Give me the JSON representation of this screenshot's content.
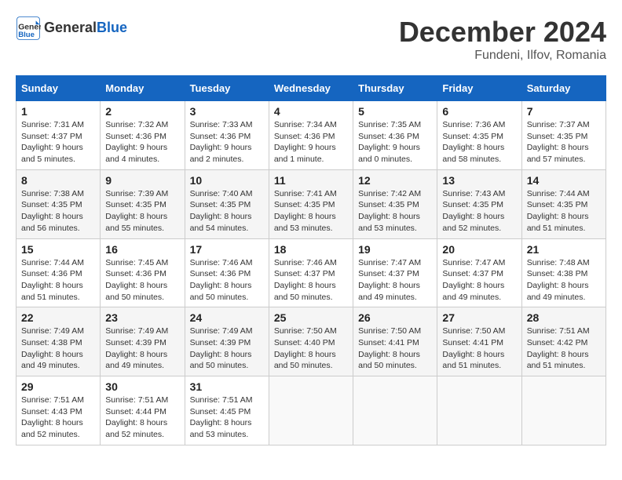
{
  "header": {
    "logo_line1": "General",
    "logo_line2": "Blue",
    "month_title": "December 2024",
    "subtitle": "Fundeni, Ilfov, Romania"
  },
  "days_of_week": [
    "Sunday",
    "Monday",
    "Tuesday",
    "Wednesday",
    "Thursday",
    "Friday",
    "Saturday"
  ],
  "weeks": [
    [
      {
        "day": "1",
        "details": "Sunrise: 7:31 AM\nSunset: 4:37 PM\nDaylight: 9 hours\nand 5 minutes."
      },
      {
        "day": "2",
        "details": "Sunrise: 7:32 AM\nSunset: 4:36 PM\nDaylight: 9 hours\nand 4 minutes."
      },
      {
        "day": "3",
        "details": "Sunrise: 7:33 AM\nSunset: 4:36 PM\nDaylight: 9 hours\nand 2 minutes."
      },
      {
        "day": "4",
        "details": "Sunrise: 7:34 AM\nSunset: 4:36 PM\nDaylight: 9 hours\nand 1 minute."
      },
      {
        "day": "5",
        "details": "Sunrise: 7:35 AM\nSunset: 4:36 PM\nDaylight: 9 hours\nand 0 minutes."
      },
      {
        "day": "6",
        "details": "Sunrise: 7:36 AM\nSunset: 4:35 PM\nDaylight: 8 hours\nand 58 minutes."
      },
      {
        "day": "7",
        "details": "Sunrise: 7:37 AM\nSunset: 4:35 PM\nDaylight: 8 hours\nand 57 minutes."
      }
    ],
    [
      {
        "day": "8",
        "details": "Sunrise: 7:38 AM\nSunset: 4:35 PM\nDaylight: 8 hours\nand 56 minutes."
      },
      {
        "day": "9",
        "details": "Sunrise: 7:39 AM\nSunset: 4:35 PM\nDaylight: 8 hours\nand 55 minutes."
      },
      {
        "day": "10",
        "details": "Sunrise: 7:40 AM\nSunset: 4:35 PM\nDaylight: 8 hours\nand 54 minutes."
      },
      {
        "day": "11",
        "details": "Sunrise: 7:41 AM\nSunset: 4:35 PM\nDaylight: 8 hours\nand 53 minutes."
      },
      {
        "day": "12",
        "details": "Sunrise: 7:42 AM\nSunset: 4:35 PM\nDaylight: 8 hours\nand 53 minutes."
      },
      {
        "day": "13",
        "details": "Sunrise: 7:43 AM\nSunset: 4:35 PM\nDaylight: 8 hours\nand 52 minutes."
      },
      {
        "day": "14",
        "details": "Sunrise: 7:44 AM\nSunset: 4:35 PM\nDaylight: 8 hours\nand 51 minutes."
      }
    ],
    [
      {
        "day": "15",
        "details": "Sunrise: 7:44 AM\nSunset: 4:36 PM\nDaylight: 8 hours\nand 51 minutes."
      },
      {
        "day": "16",
        "details": "Sunrise: 7:45 AM\nSunset: 4:36 PM\nDaylight: 8 hours\nand 50 minutes."
      },
      {
        "day": "17",
        "details": "Sunrise: 7:46 AM\nSunset: 4:36 PM\nDaylight: 8 hours\nand 50 minutes."
      },
      {
        "day": "18",
        "details": "Sunrise: 7:46 AM\nSunset: 4:37 PM\nDaylight: 8 hours\nand 50 minutes."
      },
      {
        "day": "19",
        "details": "Sunrise: 7:47 AM\nSunset: 4:37 PM\nDaylight: 8 hours\nand 49 minutes."
      },
      {
        "day": "20",
        "details": "Sunrise: 7:47 AM\nSunset: 4:37 PM\nDaylight: 8 hours\nand 49 minutes."
      },
      {
        "day": "21",
        "details": "Sunrise: 7:48 AM\nSunset: 4:38 PM\nDaylight: 8 hours\nand 49 minutes."
      }
    ],
    [
      {
        "day": "22",
        "details": "Sunrise: 7:49 AM\nSunset: 4:38 PM\nDaylight: 8 hours\nand 49 minutes."
      },
      {
        "day": "23",
        "details": "Sunrise: 7:49 AM\nSunset: 4:39 PM\nDaylight: 8 hours\nand 49 minutes."
      },
      {
        "day": "24",
        "details": "Sunrise: 7:49 AM\nSunset: 4:39 PM\nDaylight: 8 hours\nand 50 minutes."
      },
      {
        "day": "25",
        "details": "Sunrise: 7:50 AM\nSunset: 4:40 PM\nDaylight: 8 hours\nand 50 minutes."
      },
      {
        "day": "26",
        "details": "Sunrise: 7:50 AM\nSunset: 4:41 PM\nDaylight: 8 hours\nand 50 minutes."
      },
      {
        "day": "27",
        "details": "Sunrise: 7:50 AM\nSunset: 4:41 PM\nDaylight: 8 hours\nand 51 minutes."
      },
      {
        "day": "28",
        "details": "Sunrise: 7:51 AM\nSunset: 4:42 PM\nDaylight: 8 hours\nand 51 minutes."
      }
    ],
    [
      {
        "day": "29",
        "details": "Sunrise: 7:51 AM\nSunset: 4:43 PM\nDaylight: 8 hours\nand 52 minutes."
      },
      {
        "day": "30",
        "details": "Sunrise: 7:51 AM\nSunset: 4:44 PM\nDaylight: 8 hours\nand 52 minutes."
      },
      {
        "day": "31",
        "details": "Sunrise: 7:51 AM\nSunset: 4:45 PM\nDaylight: 8 hours\nand 53 minutes."
      },
      null,
      null,
      null,
      null
    ]
  ]
}
